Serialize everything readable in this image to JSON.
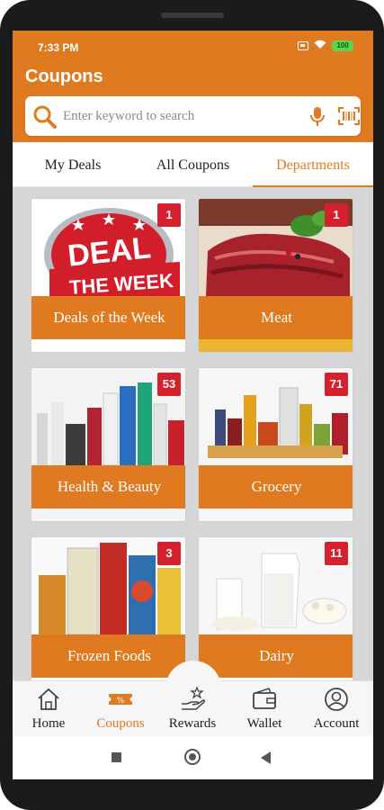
{
  "status_bar": {
    "time": "7:33 PM",
    "battery": "100"
  },
  "header": {
    "title": "Coupons"
  },
  "search": {
    "placeholder": "Enter keyword to search"
  },
  "tabs": [
    {
      "label": "My Deals",
      "active": false
    },
    {
      "label": "All Coupons",
      "active": false
    },
    {
      "label": "Departments",
      "active": true
    }
  ],
  "departments": [
    {
      "label": "Deals of the Week",
      "count": "1",
      "banner_line1": "DEAL",
      "banner_line2": "THE WEEK"
    },
    {
      "label": "Meat",
      "count": "1"
    },
    {
      "label": "Health & Beauty",
      "count": "53"
    },
    {
      "label": "Grocery",
      "count": "71"
    },
    {
      "label": "Frozen Foods",
      "count": "3"
    },
    {
      "label": "Dairy",
      "count": "11"
    }
  ],
  "bottom_nav": [
    {
      "label": "Home",
      "icon": "home-icon",
      "active": false
    },
    {
      "label": "Coupons",
      "icon": "coupon-percent-icon",
      "active": true
    },
    {
      "label": "Rewards",
      "icon": "rewards-hand-star-icon",
      "active": false
    },
    {
      "label": "Wallet",
      "icon": "wallet-icon",
      "active": false
    },
    {
      "label": "Account",
      "icon": "account-icon",
      "active": false
    }
  ],
  "colors": {
    "accent": "#e07a20",
    "badge": "#d5202e",
    "grid_bg": "#d6d6d6"
  }
}
